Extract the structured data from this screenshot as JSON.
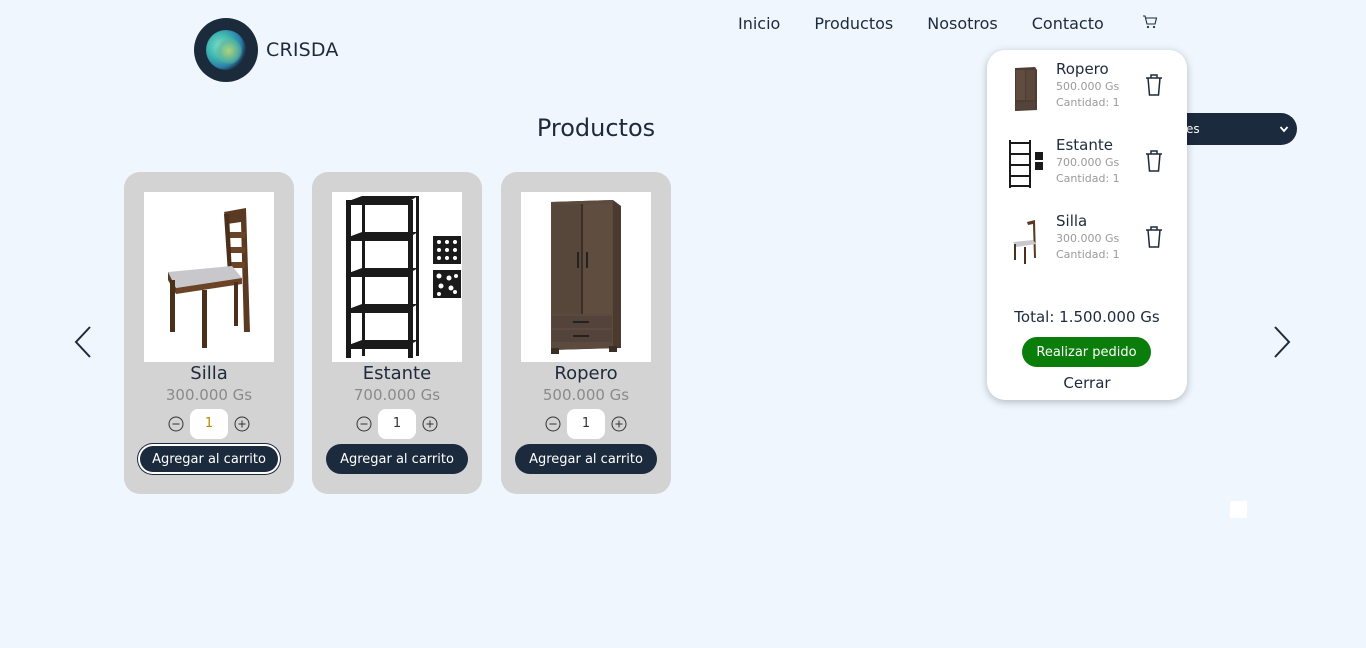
{
  "brand": {
    "name": "CRISDA",
    "logo_icon": "crisda-logo-icon"
  },
  "nav": {
    "items": [
      {
        "label": "Inicio"
      },
      {
        "label": "Productos"
      },
      {
        "label": "Nosotros"
      },
      {
        "label": "Contacto"
      }
    ],
    "cart_icon": "shopping-cart-icon"
  },
  "page_title": "Productos",
  "filter_select": {
    "visible_text": "es"
  },
  "carousel": {
    "prev_icon": "chevron-left-icon",
    "next_icon": "chevron-right-icon"
  },
  "products": [
    {
      "name": "Silla",
      "price": "300.000 Gs",
      "quantity": "1",
      "add_label": "Agregar al carrito",
      "image_icon": "chair-image"
    },
    {
      "name": "Estante",
      "price": "700.000 Gs",
      "quantity": "1",
      "add_label": "Agregar al carrito",
      "image_icon": "shelf-image"
    },
    {
      "name": "Ropero",
      "price": "500.000 Gs",
      "quantity": "1",
      "add_label": "Agregar al carrito",
      "image_icon": "wardrobe-image"
    }
  ],
  "cart": {
    "items": [
      {
        "name": "Ropero",
        "price": "500.000 Gs",
        "qty_text": "Cantidad: 1"
      },
      {
        "name": "Estante",
        "price": "700.000 Gs",
        "qty_text": "Cantidad: 1"
      },
      {
        "name": "Silla",
        "price": "300.000 Gs",
        "qty_text": "Cantidad: 1"
      }
    ],
    "total": "Total: 1.500.000 Gs",
    "order_label": "Realizar pedido",
    "close_label": "Cerrar"
  },
  "colors": {
    "background": "#eff6fd",
    "dark": "#1c2a3d",
    "card": "#d3d3d3",
    "order_green": "#0a7d0a"
  }
}
